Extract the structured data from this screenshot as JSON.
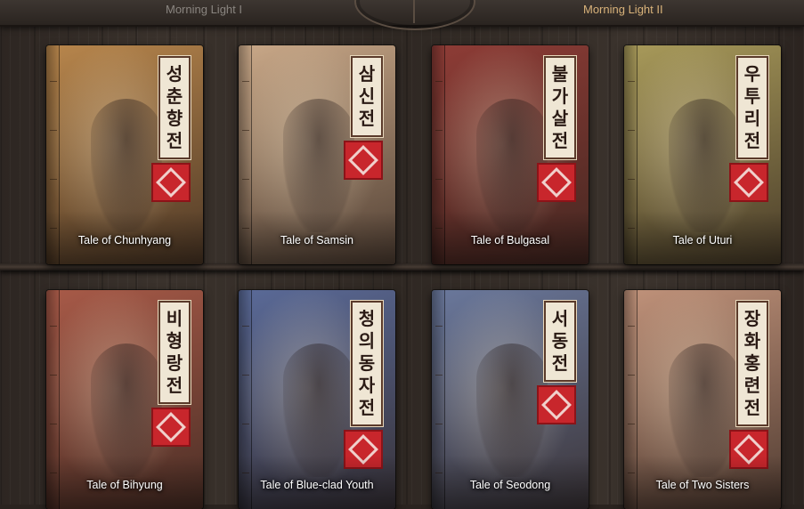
{
  "tabs": [
    {
      "label": "Morning Light I",
      "active": false
    },
    {
      "label": "Morning Light II",
      "active": true
    }
  ],
  "books": [
    {
      "korean_title": "성춘향전",
      "label": "Tale of Chunhyang",
      "color": "#b8864c"
    },
    {
      "korean_title": "삼신전",
      "label": "Tale of Samsin",
      "color": "#c9a888"
    },
    {
      "korean_title": "불가살전",
      "label": "Tale of Bulgasal",
      "color": "#8e3c36"
    },
    {
      "korean_title": "우투리전",
      "label": "Tale of Uturi",
      "color": "#a89a5a"
    },
    {
      "korean_title": "비형랑전",
      "label": "Tale of Bihyung",
      "color": "#a85a48"
    },
    {
      "korean_title": "청의동자전",
      "label": "Tale of Blue-clad Youth",
      "color": "#5a6a98"
    },
    {
      "korean_title": "서동전",
      "label": "Tale of Seodong",
      "color": "#6a789c"
    },
    {
      "korean_title": "장화홍련전",
      "label": "Tale of Two Sisters",
      "color": "#c0927a"
    }
  ]
}
